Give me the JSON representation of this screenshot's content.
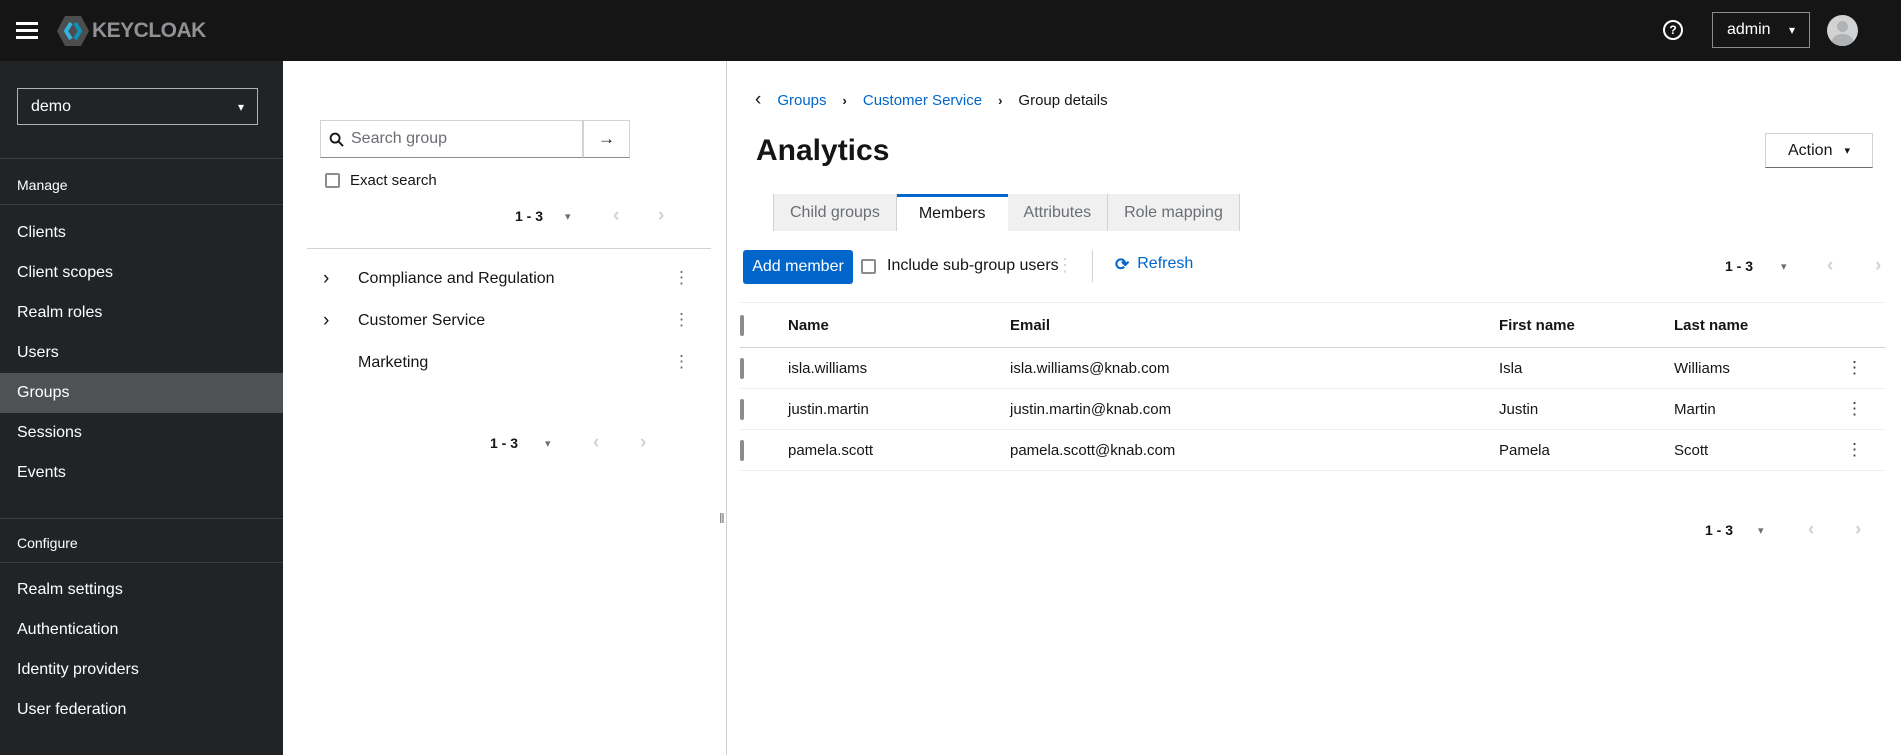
{
  "icons": {
    "help": "?",
    "caret_down": "▾",
    "kebab": "⋮",
    "chevron_prev": "‹",
    "chevron_next": "›",
    "angle_right": "›",
    "breadcrumb_sep": "›",
    "back": "‹",
    "arrow_right": "→",
    "refresh": "⟳",
    "resize_grip": "‖"
  },
  "colors": {
    "topbar_bg": "#151515",
    "sidebar_bg": "#212427",
    "sidebar_selected_bg": "#4f5255",
    "accent_blue": "#0066cc",
    "muted_gray": "#6a6e73",
    "disabled_gray": "#d2d2d2"
  },
  "topbar": {
    "brand": "KEYCLOAK",
    "user": "admin"
  },
  "sidebar": {
    "realm_select": "demo",
    "sections": [
      {
        "label": "Manage",
        "items": [
          {
            "label": "Clients"
          },
          {
            "label": "Client scopes"
          },
          {
            "label": "Realm roles"
          },
          {
            "label": "Users"
          },
          {
            "label": "Groups",
            "selected": true
          },
          {
            "label": "Sessions"
          },
          {
            "label": "Events"
          }
        ]
      },
      {
        "label": "Configure",
        "items": [
          {
            "label": "Realm settings"
          },
          {
            "label": "Authentication"
          },
          {
            "label": "Identity providers"
          },
          {
            "label": "User federation"
          }
        ]
      }
    ]
  },
  "groups_panel": {
    "search_placeholder": "Search group",
    "exact_search_label": "Exact search",
    "pagination_top": "1 - 3",
    "pagination_bottom": "1 - 3",
    "tree": [
      {
        "label": "Compliance and Regulation",
        "expandable": true
      },
      {
        "label": "Customer Service",
        "expandable": true
      },
      {
        "label": "Marketing",
        "expandable": false
      }
    ]
  },
  "main": {
    "breadcrumb": {
      "items": [
        "Groups",
        "Customer Service"
      ],
      "current": "Group details"
    },
    "title": "Analytics",
    "action_label": "Action",
    "tabs": [
      {
        "label": "Child groups",
        "active": false
      },
      {
        "label": "Members",
        "active": true
      },
      {
        "label": "Attributes",
        "active": false
      },
      {
        "label": "Role mapping",
        "active": false
      }
    ],
    "toolbar": {
      "add_member_label": "Add member",
      "include_subgroup_label": "Include sub-group users",
      "refresh_label": "Refresh",
      "pagination": "1 - 3"
    },
    "table": {
      "headers": [
        "Name",
        "Email",
        "First name",
        "Last name"
      ],
      "rows": [
        {
          "name": "isla.williams",
          "email": "isla.williams@knab.com",
          "first": "Isla",
          "last": "Williams"
        },
        {
          "name": "justin.martin",
          "email": "justin.martin@knab.com",
          "first": "Justin",
          "last": "Martin"
        },
        {
          "name": "pamela.scott",
          "email": "pamela.scott@knab.com",
          "first": "Pamela",
          "last": "Scott"
        }
      ]
    },
    "bottom_pagination": "1 - 3"
  }
}
